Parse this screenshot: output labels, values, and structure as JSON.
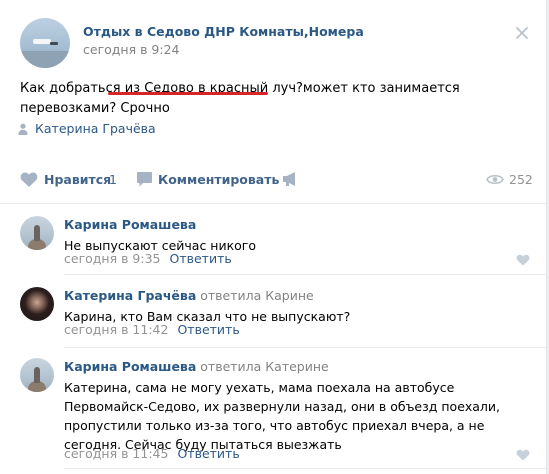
{
  "post": {
    "group_name": "Отдых в Седово ДНР Комнаты,Номера",
    "time": "сегодня в 9:24",
    "text_before": "Как добраться ",
    "text_underlined": "из Седово в красный луч",
    "text_after": "?может кто занимается перевозками? Срочно",
    "signer": "Катерина Грачёва"
  },
  "actions": {
    "like_label": "Нравится",
    "like_count": "1",
    "comment_label": "Комментировать",
    "views": "252"
  },
  "comments": [
    {
      "author": "Карина Ромашева",
      "replied": "",
      "text": "Не выпускают сейчас никого",
      "time": "сегодня в 9:35",
      "reply_label": "Ответить"
    },
    {
      "author": "Катерина Грачёва",
      "replied": "ответила Карине",
      "text": "Карина, кто Вам сказал что не выпускают?",
      "time": "сегодня в 11:42",
      "reply_label": "Ответить"
    },
    {
      "author": "Карина Ромашева",
      "replied": "ответила Катерине",
      "text": "Катерина, сама не могу уехать, мама поехала на автобусе Первомайск-Седово, их развернули назад, они в объезд поехали, пропустили только из-за того, что автобус приехал вчера, а не сегодня. Сейчас буду пытаться выезжать",
      "time": "сегодня в 11:45",
      "reply_label": "Ответить"
    }
  ],
  "colors": {
    "link": "#2a5885",
    "meta": "#939393",
    "underline_mark": "#d6262a",
    "icon": "#a5b3c4"
  }
}
